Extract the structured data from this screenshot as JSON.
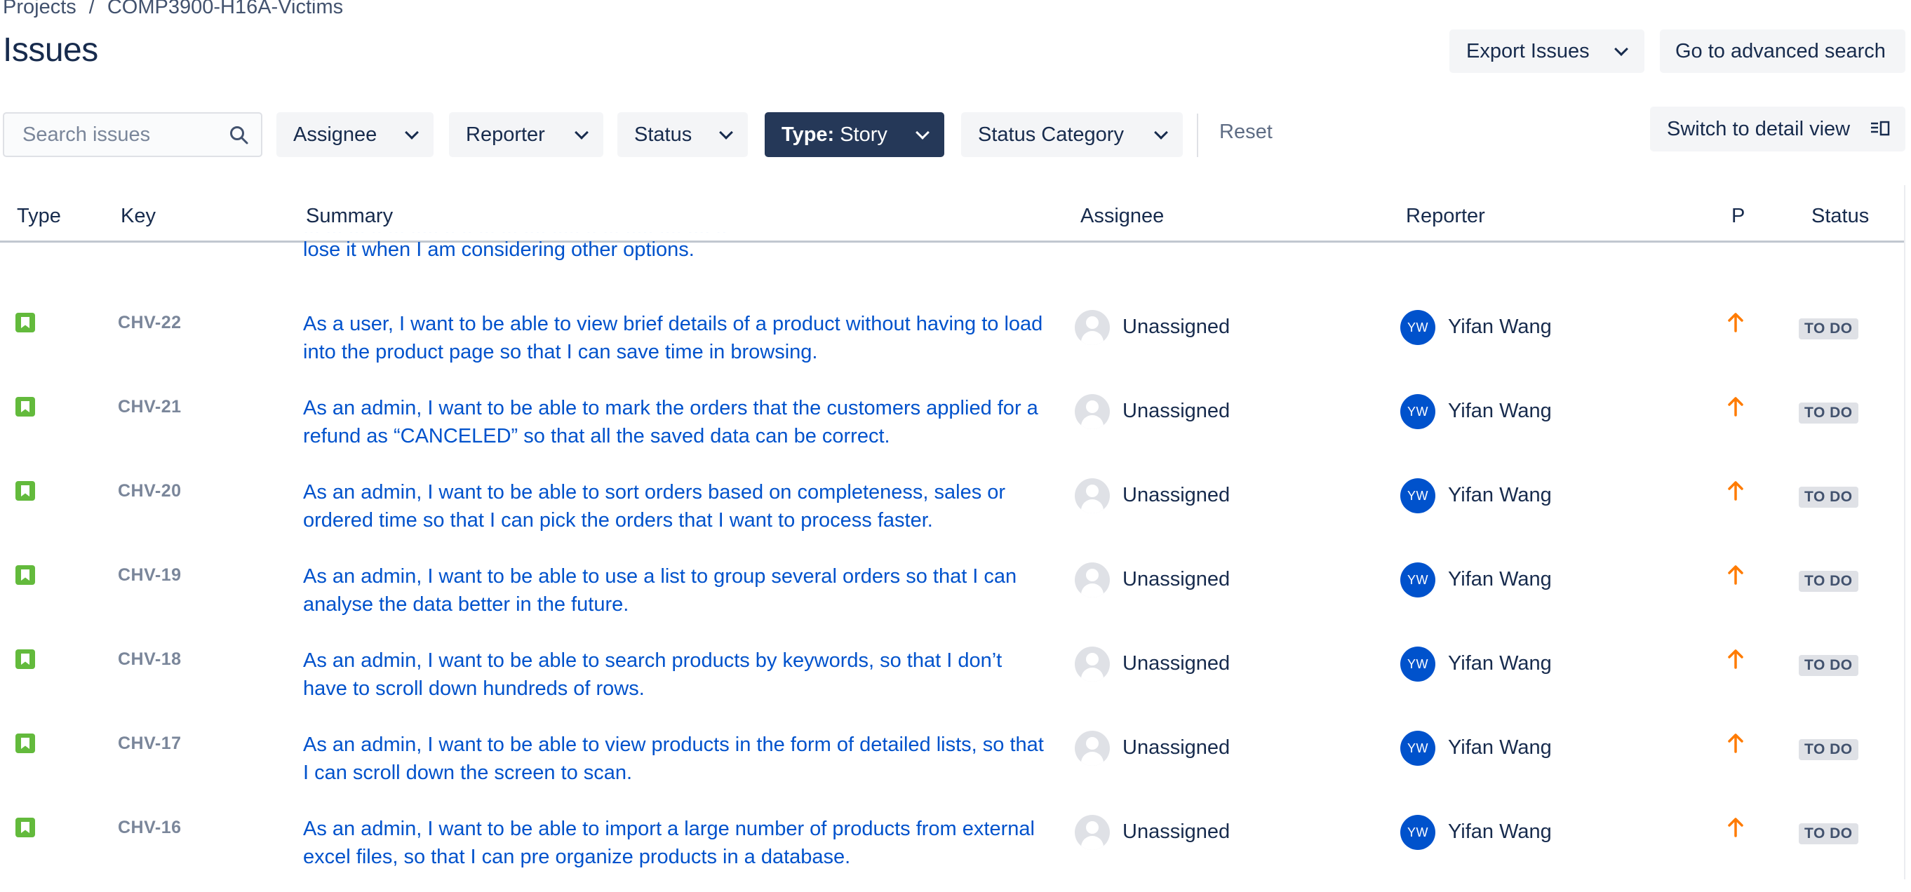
{
  "breadcrumb": {
    "projects": "Projects",
    "separator": "/",
    "project": "COMP3900-H16A-Victims"
  },
  "page_title": "Issues",
  "header_actions": {
    "export": "Export Issues",
    "advanced_search": "Go to advanced search"
  },
  "filters": {
    "search_placeholder": "Search issues",
    "assignee": "Assignee",
    "reporter": "Reporter",
    "status": "Status",
    "type_label": "Type:",
    "type_value": "Story",
    "status_category": "Status Category",
    "reset": "Reset"
  },
  "switch_view": "Switch to detail view",
  "columns": [
    "Type",
    "Key",
    "Summary",
    "Assignee",
    "Reporter",
    "P",
    "Status"
  ],
  "partial_row": {
    "line1": "... ...  ... .. ... ..... .. .. ... ... .... ..... .. ... ..... .... .... ..",
    "line2": "lose it when I am considering other options."
  },
  "rows": [
    {
      "type": "story-icon",
      "key": "CHV-22",
      "summary": "As a user, I want to be able to view brief details of a product without having to load into the product page so that I can save time in browsing.",
      "assignee": "Unassigned",
      "reporter_initials": "YW",
      "reporter": "Yifan Wang",
      "priority": "high",
      "status": "TO DO"
    },
    {
      "type": "story-icon",
      "key": "CHV-21",
      "summary": "As an admin, I want to be able to mark the orders that the customers applied for a refund as “CANCELED” so that all the saved data can be correct.",
      "assignee": "Unassigned",
      "reporter_initials": "YW",
      "reporter": "Yifan Wang",
      "priority": "high",
      "status": "TO DO"
    },
    {
      "type": "story-icon",
      "key": "CHV-20",
      "summary": "As an admin, I want to be able to sort orders based on completeness, sales or ordered time so that I can pick the orders that I want to process faster.",
      "assignee": "Unassigned",
      "reporter_initials": "YW",
      "reporter": "Yifan Wang",
      "priority": "high",
      "status": "TO DO"
    },
    {
      "type": "story-icon",
      "key": "CHV-19",
      "summary": "As an admin, I want to be able to use a list to group several orders so that I can analyse the data better in the future.",
      "assignee": "Unassigned",
      "reporter_initials": "YW",
      "reporter": "Yifan Wang",
      "priority": "high",
      "status": "TO DO"
    },
    {
      "type": "story-icon",
      "key": "CHV-18",
      "summary": "As an admin, I want to be able to search products by keywords, so that I don’t have to scroll down hundreds of rows.",
      "assignee": "Unassigned",
      "reporter_initials": "YW",
      "reporter": "Yifan Wang",
      "priority": "high",
      "status": "TO DO"
    },
    {
      "type": "story-icon",
      "key": "CHV-17",
      "summary": "As an admin, I want to be able to view products in the form of detailed lists, so that I can scroll down the screen to scan.",
      "assignee": "Unassigned",
      "reporter_initials": "YW",
      "reporter": "Yifan Wang",
      "priority": "high",
      "status": "TO DO"
    },
    {
      "type": "story-icon",
      "key": "CHV-16",
      "summary": "As an admin, I want to be able to import a large number of products from external excel files, so that I can pre organize products in a database.",
      "assignee": "Unassigned",
      "reporter_initials": "YW",
      "reporter": "Yifan Wang",
      "priority": "high",
      "status": "TO DO"
    }
  ],
  "colors": {
    "link": "#0052cc",
    "active_filter": "#253858",
    "story": "#63ba3c",
    "priority_high": "#ff7b00",
    "avatar": "#0052cc"
  }
}
